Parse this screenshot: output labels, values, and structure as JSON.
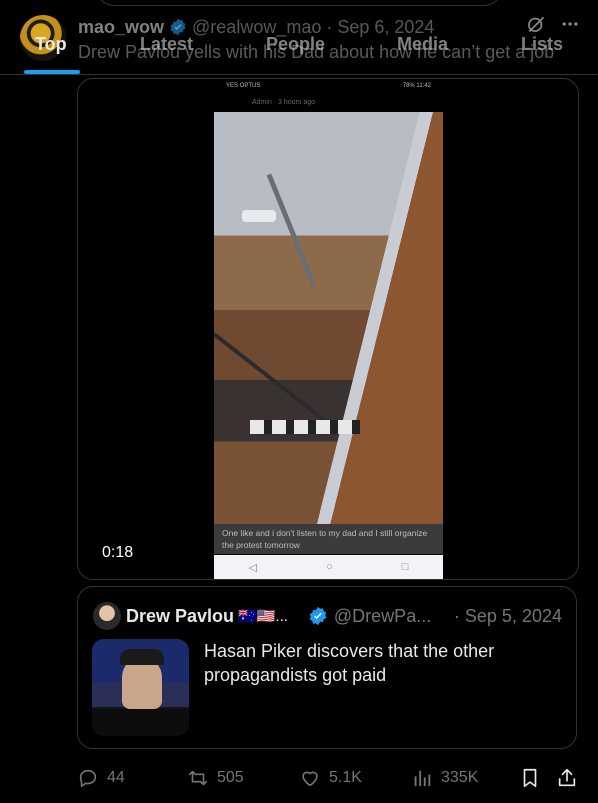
{
  "tabs": [
    {
      "label": "Top",
      "active": true
    },
    {
      "label": "Latest"
    },
    {
      "label": "People"
    },
    {
      "label": "Media"
    },
    {
      "label": "Lists"
    }
  ],
  "tweet": {
    "display_name": "mao_wow",
    "handle": "@realwow_mao",
    "date_sep": "·",
    "date": "Sep 6, 2024",
    "text": "Drew Pavlou yells with his Dad about how he can’t get a job",
    "video": {
      "duration": "0:18",
      "phone_status_left": "YES OPTUS",
      "phone_status_right": "78% 11:42",
      "phone_meta": "Admin · 3 hours ago",
      "caption": "One like and i don't listen to my dad and I still organize the protest tomorrow"
    }
  },
  "quote": {
    "display_name": "Drew Pavlou",
    "flags": "🇦🇺🇺🇸...",
    "handle": "@DrewPa...",
    "date": "· Sep 5, 2024",
    "text": "Hasan Piker discovers that the other propagandists got paid"
  },
  "actions": {
    "replies": "44",
    "reposts": "505",
    "likes": "5.1K",
    "views": "335K"
  },
  "colors": {
    "accent": "#1d9bf0",
    "background": "#000000",
    "border": "#2f3336",
    "muted": "#71767b"
  },
  "icons": [
    "grok-icon",
    "more-icon",
    "verified-badge-icon",
    "reply-icon",
    "repost-icon",
    "like-icon",
    "views-icon",
    "bookmark-icon",
    "share-icon"
  ]
}
